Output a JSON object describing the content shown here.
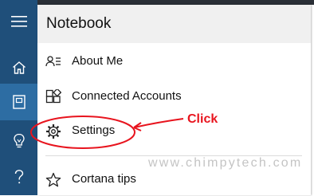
{
  "rail": {
    "items": [
      {
        "icon": "hamburger-menu-icon"
      },
      {
        "icon": "home-icon"
      },
      {
        "icon": "notebook-icon",
        "active": true
      },
      {
        "icon": "lightbulb-icon"
      },
      {
        "icon": "help-icon"
      }
    ]
  },
  "panel": {
    "title": "Notebook",
    "items": [
      {
        "label": "About Me",
        "icon": "about-me-icon"
      },
      {
        "label": "Connected Accounts",
        "icon": "connected-accounts-icon"
      },
      {
        "label": "Settings",
        "icon": "gear-icon"
      },
      {
        "label": "Cortana tips",
        "icon": "star-icon"
      }
    ]
  },
  "annotation": {
    "click_label": "Click",
    "color": "#e8141e"
  },
  "watermark": "www.chimpytech.com",
  "colors": {
    "rail": "#1f4f7a",
    "rail_active": "#2d6da3",
    "header": "#f0f0f0"
  }
}
